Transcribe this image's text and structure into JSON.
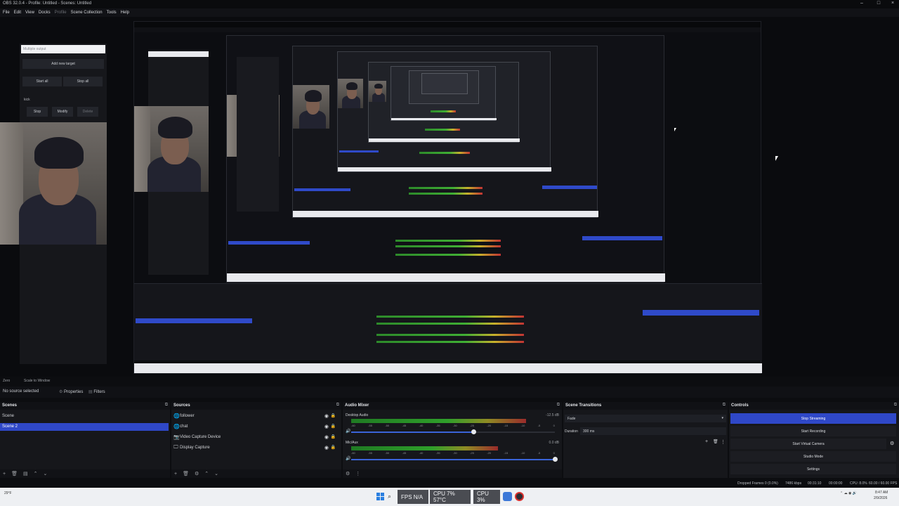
{
  "titlebar": {
    "title": "OBS 32.0.4 - Profile: Untitled - Scenes: Untitled",
    "minimize": "–",
    "maximize": "□",
    "close": "×"
  },
  "menu": [
    "File",
    "Edit",
    "View",
    "Docks",
    "Profile",
    "Scene Collection",
    "Tools",
    "Help"
  ],
  "multiple_output": {
    "input_placeholder": "Multiple output",
    "add_target": "Add new target",
    "start_all": "Start all",
    "stop_all": "Stop all",
    "target_label": "kick",
    "stop": "Stop",
    "modify": "Modify",
    "delete": "Delete"
  },
  "subbar": {
    "left": "Zero",
    "mode": "Scale to Window"
  },
  "propbar": {
    "no_source": "No source selected",
    "properties": "Properties",
    "filters": "Filters"
  },
  "scenes": {
    "title": "Scenes",
    "items": [
      {
        "label": "Scene"
      },
      {
        "label": "Scene 2"
      }
    ]
  },
  "sources": {
    "title": "Sources",
    "items": [
      {
        "label": "follower",
        "icon": "🌐"
      },
      {
        "label": "chat",
        "icon": "🌐"
      },
      {
        "label": "Video Capture Device",
        "icon": "📷"
      },
      {
        "label": "Display Capture",
        "icon": "🖵"
      }
    ]
  },
  "audio_mixer": {
    "title": "Audio Mixer",
    "channels": [
      {
        "name": "Desktop Audio",
        "db": "-12.5 dB",
        "level": 0.86,
        "volume": 0.6
      },
      {
        "name": "Mic/Aux",
        "db": "0.0 dB",
        "level": 0.72,
        "volume": 1.0
      }
    ],
    "ticks": [
      "-60",
      "-55",
      "-50",
      "-45",
      "-40",
      "-35",
      "-30",
      "-25",
      "-20",
      "-15",
      "-10",
      "-5",
      "0"
    ]
  },
  "scene_transitions": {
    "title": "Scene Transitions",
    "transition": "Fade",
    "duration_label": "Duration",
    "duration": "300 ms"
  },
  "controls": {
    "title": "Controls",
    "buttons": [
      "Stop Streaming",
      "Start Recording",
      "Start Virtual Camera",
      "Studio Mode",
      "Settings"
    ]
  },
  "status": {
    "dropped": "Dropped Frames 0 (0.0%)",
    "kbps": "7486 kbps",
    "stream_time": "00:31:10",
    "rec_time": "00:00:00",
    "cpu": "CPU: 8.0%",
    "fps": "60.00 / 60.00 FPS"
  },
  "taskbar": {
    "weather": "29°F",
    "fps": "FPS N/A",
    "cpu_temp": "CPU 7% 57°C",
    "cpu2": "CPU 3%",
    "time": "8:47 AM",
    "date": "2/9/2026"
  },
  "colors": {
    "accent": "#2f48c8",
    "bg": "#16171b",
    "taskbar": "#eef0f3"
  }
}
